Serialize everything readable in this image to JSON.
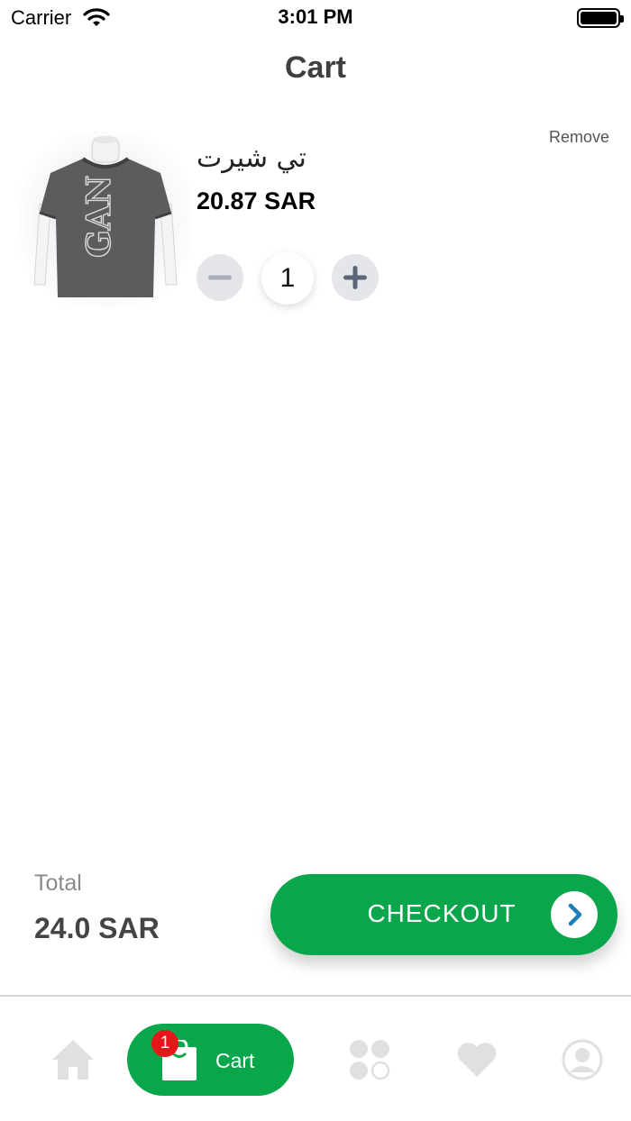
{
  "status_bar": {
    "carrier": "Carrier",
    "time": "3:01 PM"
  },
  "header": {
    "title": "Cart"
  },
  "cart_items": [
    {
      "name": "تي شيرت",
      "price": "20.87 SAR",
      "quantity": "1",
      "remove_label": "Remove",
      "image_icon": "t-shirt-product-image"
    }
  ],
  "summary": {
    "total_label": "Total",
    "total_value": "24.0 SAR"
  },
  "checkout": {
    "label": "CHECKOUT",
    "icon": "chevron-right-icon"
  },
  "tab_bar": {
    "items": [
      {
        "icon": "home-icon",
        "active": false
      },
      {
        "icon": "shopping-bag-icon",
        "label": "Cart",
        "badge": "1",
        "active": true
      },
      {
        "icon": "categories-icon",
        "active": false
      },
      {
        "icon": "heart-icon",
        "active": false
      },
      {
        "icon": "profile-icon",
        "active": false
      }
    ]
  },
  "colors": {
    "accent": "#0aa64c",
    "badge": "#e5171b",
    "tab_inactive": "#dfe0e2"
  }
}
